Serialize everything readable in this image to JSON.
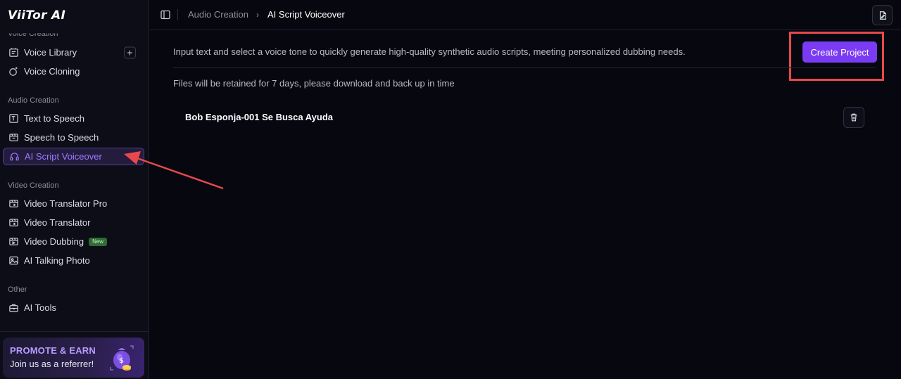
{
  "app": {
    "logo_text": "ViiTor AI"
  },
  "sidebar": {
    "sections": {
      "voice_creation": "Voice Creation",
      "audio_creation": "Audio Creation",
      "video_creation": "Video Creation",
      "other": "Other"
    },
    "items": [
      {
        "label": "Voice Library",
        "icon": "library-icon"
      },
      {
        "label": "Voice Cloning",
        "icon": "cloning-icon"
      },
      {
        "label": "Text to Speech",
        "icon": "text-to-speech-icon"
      },
      {
        "label": "Speech to Speech",
        "icon": "speech-to-speech-icon"
      },
      {
        "label": "AI Script Voiceover",
        "icon": "headphones-icon",
        "active": true
      },
      {
        "label": "Video Translator Pro",
        "icon": "video-translate-icon"
      },
      {
        "label": "Video Translator",
        "icon": "video-translate-icon"
      },
      {
        "label": "Video Dubbing",
        "icon": "video-dubbing-icon",
        "badge": "New"
      },
      {
        "label": "AI Talking Photo",
        "icon": "photo-icon"
      },
      {
        "label": "AI Tools",
        "icon": "toolbox-icon"
      }
    ],
    "add_symbol": "+",
    "promo": {
      "title": "PROMOTE & EARN",
      "subtitle": "Join us as a referrer!"
    }
  },
  "header": {
    "breadcrumb_parent": "Audio Creation",
    "breadcrumb_separator": "›",
    "breadcrumb_current": "AI Script Voiceover"
  },
  "main": {
    "description": "Input text and select a voice tone to quickly generate high-quality synthetic audio scripts, meeting personalized dubbing needs.",
    "create_button": "Create Project",
    "retention_notice": "Files will be retained for 7 days, please download and back up in time",
    "projects": [
      {
        "title": "Bob Esponja-001 Se Busca Ayuda"
      }
    ]
  },
  "colors": {
    "accent": "#7a3bf2",
    "active_text": "#9d7bff",
    "highlight": "#e8484c",
    "badge_bg": "#2f6b33"
  }
}
